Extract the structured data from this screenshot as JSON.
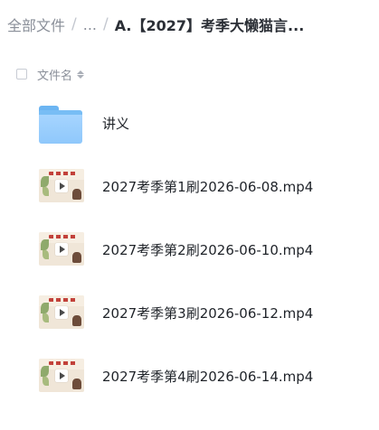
{
  "breadcrumb": {
    "root": "全部文件",
    "ellipsis": "...",
    "separator": "/",
    "current": "A.【2027】考季大懒猫言..."
  },
  "list_header": {
    "name_column": "文件名"
  },
  "files": [
    {
      "name": "讲义",
      "type": "folder",
      "icon": "folder-icon"
    },
    {
      "name": "2027考季第1刷2026-06-08.mp4",
      "type": "video",
      "icon": "video-thumbnail"
    },
    {
      "name": "2027考季第2刷2026-06-10.mp4",
      "type": "video",
      "icon": "video-thumbnail"
    },
    {
      "name": "2027考季第3刷2026-06-12.mp4",
      "type": "video",
      "icon": "video-thumbnail"
    },
    {
      "name": "2027考季第4刷2026-06-14.mp4",
      "type": "video",
      "icon": "video-thumbnail"
    }
  ],
  "colors": {
    "folder": "#8fc8fb",
    "text_primary": "#1f2329",
    "text_secondary": "#8a8f99"
  }
}
